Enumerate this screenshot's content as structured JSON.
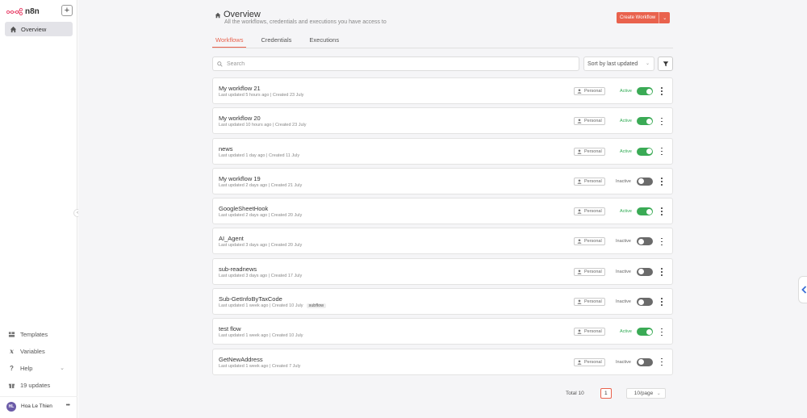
{
  "app": {
    "brand": "n8n"
  },
  "sidebar": {
    "nav": [
      {
        "label": "Overview",
        "icon": "home-icon"
      }
    ],
    "bottom": [
      {
        "label": "Templates",
        "icon": "template-icon"
      },
      {
        "label": "Variables",
        "icon": "variables-icon"
      },
      {
        "label": "Help",
        "icon": "help-icon"
      },
      {
        "label": "19 updates",
        "icon": "gift-icon"
      }
    ],
    "user": {
      "initials": "HL",
      "name": "Hoa Le Thien"
    }
  },
  "header": {
    "title": "Overview",
    "subtitle": "All the workflows, credentials and executions you have access to",
    "create_label": "Create Workflow"
  },
  "tabs": [
    {
      "label": "Workflows",
      "active": true
    },
    {
      "label": "Credentials",
      "active": false
    },
    {
      "label": "Executions",
      "active": false
    }
  ],
  "search": {
    "placeholder": "Search",
    "value": ""
  },
  "sort": {
    "value": "Sort by last updated"
  },
  "workflows": [
    {
      "name": "My workflow 21",
      "updated": "Last updated 5 hours ago",
      "created": "Created 23 July",
      "owner": "Personal",
      "status": "Active",
      "active": true,
      "tag": ""
    },
    {
      "name": "My workflow 20",
      "updated": "Last updated 10 hours ago",
      "created": "Created 23 July",
      "owner": "Personal",
      "status": "Active",
      "active": true,
      "tag": ""
    },
    {
      "name": "news",
      "updated": "Last updated 1 day ago",
      "created": "Created 11 July",
      "owner": "Personal",
      "status": "Active",
      "active": true,
      "tag": ""
    },
    {
      "name": "My workflow 19",
      "updated": "Last updated 2 days ago",
      "created": "Created 21 July",
      "owner": "Personal",
      "status": "Inactive",
      "active": false,
      "tag": ""
    },
    {
      "name": "GoogleSheetHook",
      "updated": "Last updated 2 days ago",
      "created": "Created 20 July",
      "owner": "Personal",
      "status": "Active",
      "active": true,
      "tag": ""
    },
    {
      "name": "AI_Agent",
      "updated": "Last updated 3 days ago",
      "created": "Created 20 July",
      "owner": "Personal",
      "status": "Inactive",
      "active": false,
      "tag": ""
    },
    {
      "name": "sub-readnews",
      "updated": "Last updated 3 days ago",
      "created": "Created 17 July",
      "owner": "Personal",
      "status": "Inactive",
      "active": false,
      "tag": ""
    },
    {
      "name": "Sub-GetInfoByTaxCode",
      "updated": "Last updated 1 week ago",
      "created": "Created 10 July",
      "owner": "Personal",
      "status": "Inactive",
      "active": false,
      "tag": "subflow"
    },
    {
      "name": "test flow",
      "updated": "Last updated 1 week ago",
      "created": "Created 10 July",
      "owner": "Personal",
      "status": "Active",
      "active": true,
      "tag": ""
    },
    {
      "name": "GetNewAddress",
      "updated": "Last updated 1 week ago",
      "created": "Created 7 July",
      "owner": "Personal",
      "status": "Inactive",
      "active": false,
      "tag": ""
    }
  ],
  "pagination": {
    "total": "Total 10",
    "page": "1",
    "per_page": "10/page"
  },
  "colors": {
    "accent": "#e9624d",
    "active": "#3aaa55",
    "inactive": "#6a6a6a"
  }
}
